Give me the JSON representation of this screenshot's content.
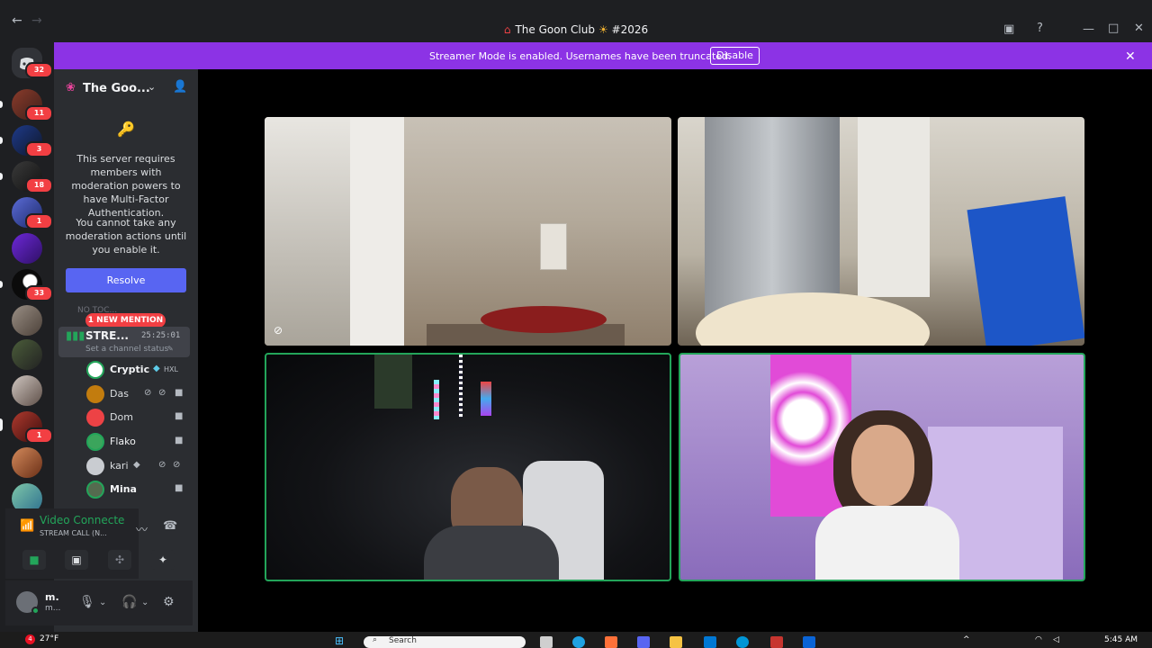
{
  "window": {
    "title": "The Goon Club",
    "channel_number": "#2026",
    "back_icon": "arrow-left-icon",
    "forward_icon": "arrow-right-icon"
  },
  "banner": {
    "text": "Streamer Mode is enabled. Usernames have been truncated.",
    "disable_label": "Disable",
    "color": "#8c33e5"
  },
  "rail": {
    "home_badge": "32",
    "servers": [
      {
        "badge": "11"
      },
      {
        "badge": "3"
      },
      {
        "badge": "18"
      },
      {
        "badge": "1"
      },
      {
        "badge": ""
      },
      {
        "badge": "33"
      },
      {
        "badge": ""
      },
      {
        "badge": ""
      },
      {
        "badge": ""
      },
      {
        "badge": "1"
      },
      {
        "badge": ""
      },
      {
        "badge": ""
      }
    ]
  },
  "sidebar": {
    "server_name": "The Goo...",
    "mfa_message": "This server requires members with moderation powers to have Multi-Factor Authentication.",
    "mfa_warning": "You cannot take any moderation actions until you enable it.",
    "resolve_label": "Resolve",
    "category_label": "NO TOC...",
    "mention_label": "1 NEW MENTION",
    "voice_channel": {
      "name": "STRE...",
      "timer": "25:25:01",
      "status": "Set a channel status"
    },
    "members": [
      {
        "name": "Cryptic",
        "tag": "HXL",
        "color": "#dbdee1"
      },
      {
        "name": "Das",
        "tag": "",
        "color": "#c27c0e"
      },
      {
        "name": "Dom",
        "tag": "",
        "color": "#ed4245"
      },
      {
        "name": "Flako",
        "tag": "",
        "color": "#3ba55c"
      },
      {
        "name": "kari",
        "tag": "",
        "color": "#b5bac1"
      },
      {
        "name": "Mina",
        "tag": "",
        "color": "#3ba55c"
      }
    ]
  },
  "voice_panel": {
    "title": "Video Connecte",
    "subtitle": "STREAM CALL (N...",
    "accent": "#23a55a"
  },
  "user": {
    "name": "m.",
    "status": "m..."
  },
  "taskbar": {
    "weather_badge": "4",
    "temperature": "27°F",
    "search_placeholder": "Search",
    "time": "5:45 AM"
  }
}
